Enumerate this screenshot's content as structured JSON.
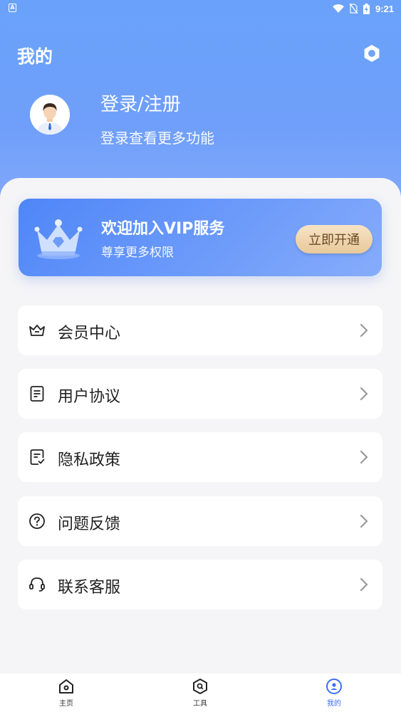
{
  "status_bar": {
    "left_icon": "A",
    "time": "9:21",
    "icons": [
      "wifi-icon",
      "no-sim-icon",
      "battery-charging-icon"
    ]
  },
  "header": {
    "title": "我的",
    "settings_icon": "settings-hexagon-icon"
  },
  "profile": {
    "login_title": "登录/注册",
    "login_subtitle": "登录查看更多功能"
  },
  "vip": {
    "title": "欢迎加入VIP服务",
    "subtitle": "尊享更多权限",
    "button_label": "立即开通",
    "icon": "crown-icon"
  },
  "menu": {
    "items": [
      {
        "label": "会员中心",
        "icon": "crown-outline-icon"
      },
      {
        "label": "用户协议",
        "icon": "document-icon"
      },
      {
        "label": "隐私政策",
        "icon": "document-check-icon"
      },
      {
        "label": "问题反馈",
        "icon": "question-circle-icon"
      },
      {
        "label": "联系客服",
        "icon": "headset-icon"
      }
    ]
  },
  "bottom_nav": {
    "items": [
      {
        "label": "主页",
        "icon": "home-icon",
        "active": false
      },
      {
        "label": "工具",
        "icon": "tools-hexagon-icon",
        "active": false
      },
      {
        "label": "我的",
        "icon": "profile-icon",
        "active": true
      }
    ]
  },
  "colors": {
    "header_gradient_top": "#6aa2fb",
    "accent_blue": "#3b6ef6",
    "vip_button_gold": "#e8c99b",
    "background": "#f5f5f7"
  }
}
